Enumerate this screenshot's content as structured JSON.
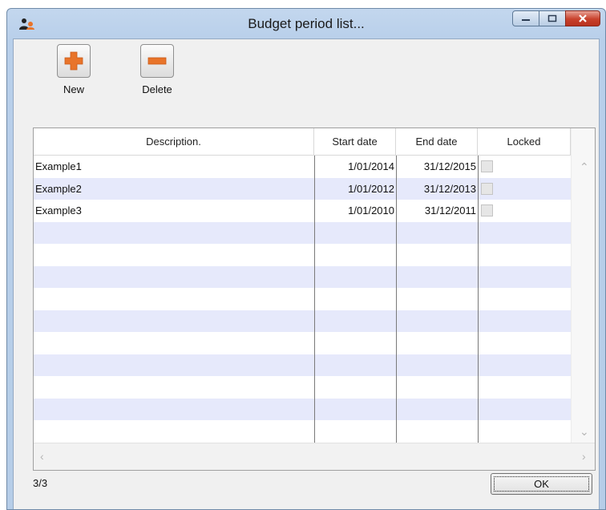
{
  "window": {
    "title": "Budget period list..."
  },
  "toolbar": {
    "new_label": "New",
    "delete_label": "Delete"
  },
  "table": {
    "columns": [
      "Description.",
      "Start date",
      "End date",
      "Locked"
    ],
    "rows": [
      {
        "description": "Example1",
        "start_date": "1/01/2014",
        "end_date": "31/12/2015",
        "locked": false
      },
      {
        "description": "Example2",
        "start_date": "1/01/2012",
        "end_date": "31/12/2013",
        "locked": false
      },
      {
        "description": "Example3",
        "start_date": "1/01/2010",
        "end_date": "31/12/2011",
        "locked": false
      }
    ]
  },
  "status": {
    "count": "3/3"
  },
  "footer": {
    "ok_label": "OK"
  },
  "colors": {
    "accent_orange": "#e8742a",
    "row_alt": "#e6e9fb",
    "close_red": "#c8412c"
  }
}
